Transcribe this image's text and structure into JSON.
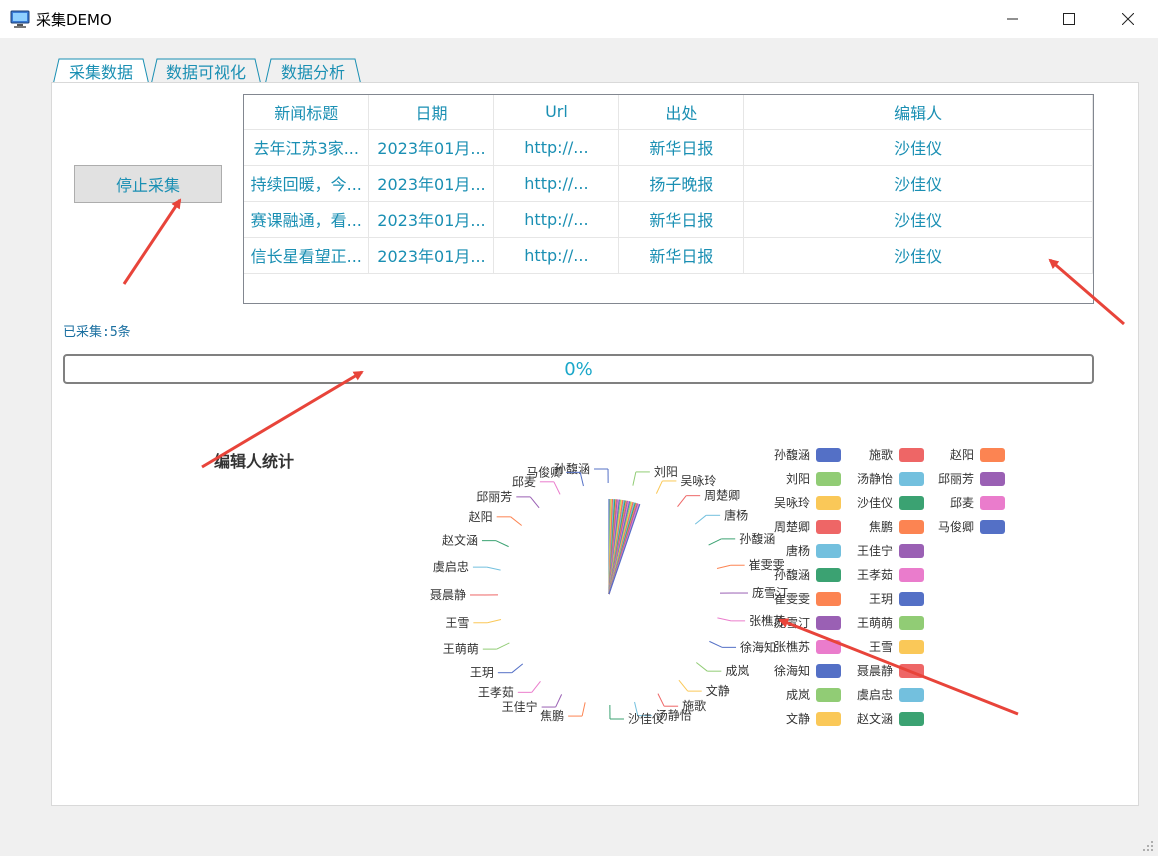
{
  "window": {
    "title": "采集DEMO",
    "minimize_glyph": "—",
    "maximize_glyph": "☐",
    "close_glyph": "✕"
  },
  "tabs": [
    {
      "label": "采集数据",
      "selected": true
    },
    {
      "label": "数据可视化",
      "selected": false
    },
    {
      "label": "数据分析",
      "selected": false
    }
  ],
  "collect": {
    "stop_button_label": "停止采集",
    "count_text": "已采集:5条",
    "progress_text": "0%",
    "progress_value": 0
  },
  "table": {
    "columns": [
      "新闻标题",
      "日期",
      "Url",
      "出处",
      "编辑人"
    ],
    "rows": [
      [
        "去年江苏3家...",
        "2023年01月...",
        "http://...",
        "新华日报",
        "沙佳仪"
      ],
      [
        "持续回暖，今...",
        "2023年01月...",
        "http://...",
        "扬子晚报",
        "沙佳仪"
      ],
      [
        "赛课融通，看...",
        "2023年01月...",
        "http://...",
        "新华日报",
        "沙佳仪"
      ],
      [
        "信长星看望正...",
        "2023年01月...",
        "http://...",
        "新华日报",
        "沙佳仪"
      ]
    ]
  },
  "colors": {
    "accent_text": "#1a8fb3",
    "annotation_arrow": "#e8443a",
    "palette": [
      "#5470c6",
      "#91cc75",
      "#fac858",
      "#ee6666",
      "#73c0de",
      "#3ba272",
      "#fc8452",
      "#9a60b4",
      "#ea7ccc"
    ]
  },
  "chart_data": {
    "type": "pie",
    "title": "编辑人统计",
    "legend_position": "right",
    "categories": [
      "孙馥涵",
      "刘阳",
      "吴咏玲",
      "周楚卿",
      "唐杨",
      "孙馥涵",
      "崔雯雯",
      "庞雪汀",
      "张樵苏",
      "徐海知",
      "成岚",
      "文静",
      "施歌",
      "汤静怡",
      "沙佳仪",
      "焦鹏",
      "王佳宁",
      "王孝茹",
      "王玥",
      "王萌萌",
      "王雪",
      "聂晨静",
      "虞启忠",
      "赵文涵",
      "赵阳",
      "邱丽芳",
      "邱麦",
      "马俊卿"
    ],
    "values": [
      0,
      0,
      0,
      0,
      0,
      0,
      0,
      0,
      0,
      0,
      0,
      0,
      0,
      0,
      5,
      0,
      0,
      0,
      0,
      0,
      0,
      0,
      0,
      0,
      0,
      0,
      0,
      0
    ],
    "legend": [
      "孙馥涵",
      "刘阳",
      "吴咏玲",
      "周楚卿",
      "唐杨",
      "孙馥涵",
      "崔雯雯",
      "庞雪汀",
      "张樵苏",
      "徐海知",
      "成岚",
      "文静",
      "施歌",
      "汤静怡",
      "沙佳仪",
      "焦鹏",
      "王佳宁",
      "王孝茹",
      "王玥",
      "王萌萌",
      "王雪",
      "聂晨静",
      "虞启忠",
      "赵文涵",
      "赵阳",
      "邱丽芳",
      "邱麦",
      "马俊卿"
    ]
  }
}
